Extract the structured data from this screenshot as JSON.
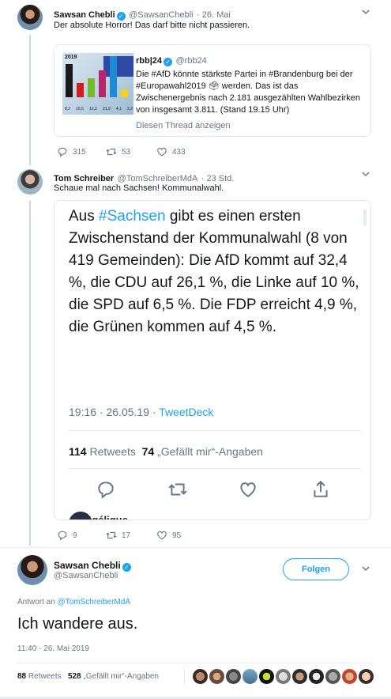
{
  "tweet1": {
    "name": "Sawsan Chebli",
    "handle": "@SawsanChebli",
    "date": "· 26. Mai",
    "text": "Der absolute Horror! Das darf bitte nicht passieren.",
    "quote": {
      "name": "rbb|24",
      "handle": "@rbb24",
      "text": "Die #AfD könnte stärkste Partei in #Brandenburg bei der #Europawahl2019 🗳 werden. Das ist das Zwischenergebnis nach 2.181 ausgezählten Wahlbezirken von insgesamt 3.811. (Stand 19.15 Uhr)",
      "thread_link": "Diesen Thread anzeigen",
      "thumb_year": "2019",
      "thumb_values": [
        "8,2",
        "10,5",
        "12,2",
        "21,9",
        "4,1",
        "2,2"
      ]
    },
    "replies": "315",
    "retweets": "53",
    "likes": "433"
  },
  "tweet2": {
    "name": "Tom Schreiber",
    "handle": "@TomSchreiberMdA",
    "date": "· 23 Std.",
    "text": "Schaue mal nach Sachsen! Kommunalwahl.",
    "embed": {
      "text_prefix": "Aus ",
      "hashtag": "#Sachsen",
      "text_rest": " gibt es einen ersten Zwischenstand der Kommunalwahl (8 von 419 Gemeinden): Die AfD kommt auf 32,4 %, die CDU auf 26,1 %, die Linke auf 10 %, die SPD auf 6,5 %. Die FDP erreicht 4,9 %, die Grünen kommen auf 4,5 %.",
      "time": "19:16 · 26.05.19 · ",
      "via": "TweetDeck",
      "retweets_count": "114",
      "retweets_label": "Retweets",
      "likes_count": "74",
      "likes_label": "„Gefällt mir“-Angaben",
      "next_name": "Angélique"
    },
    "replies": "9",
    "retweets": "17",
    "likes": "95"
  },
  "main_tweet": {
    "name": "Sawsan Chebli",
    "handle": "@SawsanChebli",
    "follow_label": "Folgen",
    "reply_prefix": "Antwort an ",
    "reply_handle": "@TomSchreiberMdA",
    "text": "Ich wandere aus.",
    "timestamp": "11:40 - 26. Mai 2019",
    "retweets_count": "88",
    "retweets_label": "Retweets",
    "likes_count": "528",
    "likes_label": "„Gefällt mir“-Angaben"
  },
  "colors": {
    "accent": "#1da1f2",
    "muted": "#657786",
    "border": "#e1e8ed"
  }
}
